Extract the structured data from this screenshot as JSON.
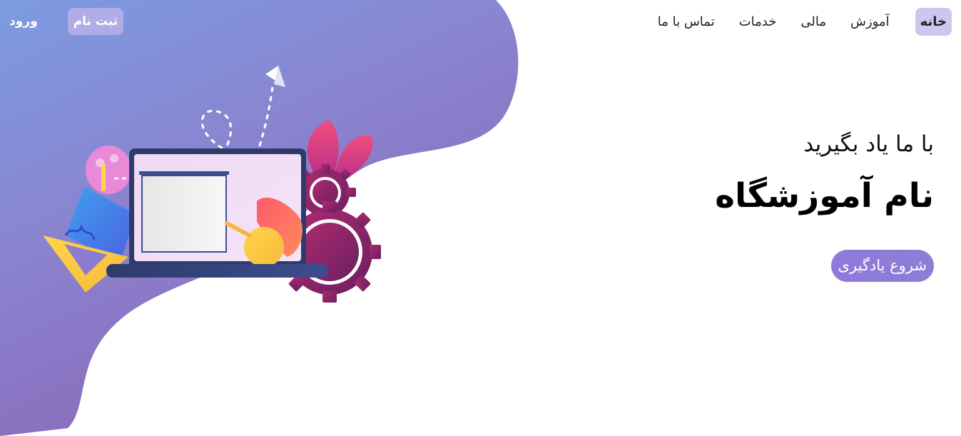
{
  "nav": {
    "items": [
      {
        "label": "خانه",
        "active": true
      },
      {
        "label": "آموزش",
        "active": false
      },
      {
        "label": "مالی",
        "active": false
      },
      {
        "label": "خدمات",
        "active": false
      },
      {
        "label": "تماس با ما",
        "active": false
      }
    ]
  },
  "auth": {
    "register_label": "ثبت نام",
    "login_label": "ورود"
  },
  "hero": {
    "subtitle": "با ما یاد بگیرید",
    "title": "نام آموزشگاه",
    "cta_label": "شروع یادگیری"
  },
  "colors": {
    "blob_start": "#7f98e0",
    "blob_mid": "#8b84d2",
    "blob_end": "#8a68b8",
    "active_nav_bg": "#cdc6ef",
    "cta_bg": "#8f7ad7"
  },
  "illustration": {
    "icons": [
      "laptop-icon",
      "gear-icon",
      "paper-plane-icon",
      "ruler-triangle-icon",
      "palette-icon",
      "leaf-icon"
    ]
  }
}
